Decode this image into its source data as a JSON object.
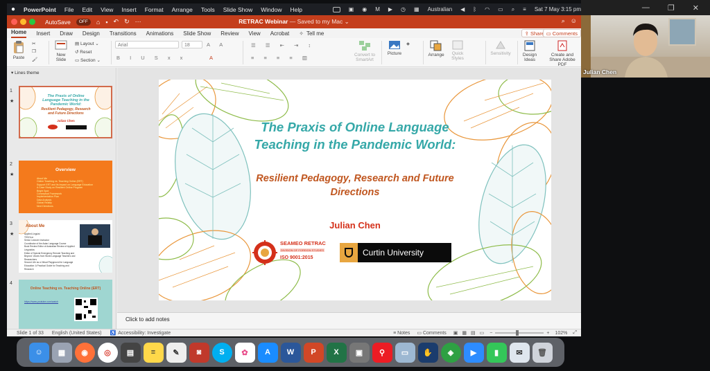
{
  "menubar": {
    "app": "PowerPoint",
    "items": [
      "File",
      "Edit",
      "View",
      "Insert",
      "Format",
      "Arrange",
      "Tools",
      "Slide Show",
      "Window",
      "Help"
    ],
    "language": "Australian",
    "datetime": "Sat 7 May  3:15 pm"
  },
  "titlebar": {
    "autosave_label": "AutoSave",
    "autosave_state": "OFF",
    "doc_name": "RETRAC Webinar",
    "saved_status": "— Saved to my Mac ⌄"
  },
  "tabs": [
    "Home",
    "Insert",
    "Draw",
    "Design",
    "Transitions",
    "Animations",
    "Slide Show",
    "Review",
    "View",
    "Acrobat"
  ],
  "tellme": "Tell me",
  "share_label": "Share",
  "comments_label": "Comments",
  "ribbon": {
    "paste": "Paste",
    "new_slide": "New Slide",
    "layout": "Layout ⌄",
    "reset": "Reset",
    "section": "Section ⌄",
    "font_name": "Arial",
    "font_size": "18",
    "convert_smartart": "Convert to SmartArt",
    "picture": "Picture",
    "arrange": "Arrange",
    "quick_styles": "Quick Styles",
    "sensitivity": "Sensitivity",
    "design_ideas": "Design Ideas",
    "create_share_pdf": "Create and Share Adobe PDF"
  },
  "thumbnails": {
    "panel_title": "Lines theme",
    "slides": [
      {
        "num": "1",
        "star": "★",
        "title": "The Praxis of Online Language Teaching in the Pandemic World:",
        "subtitle": "Resilient Pedagogy, Research and Future Directions",
        "author": "Julian Chen"
      },
      {
        "num": "2",
        "star": "★",
        "title": "Overview",
        "items": [
          "About Me",
          "Online Teaching vs. Teaching Online (ERT)",
          "Support ERT and Its Impact on Language Education",
          "A Case Study on Resilient Online Program",
          "Bright Spot",
          "Conceptual Framework",
          "Implementation Plan",
          "Data Analysis",
          "Global Reality",
          "Next Directions"
        ]
      },
      {
        "num": "3",
        "star": "★",
        "title": "About Me",
        "items": [
          "Applied Linguist",
          "TESOLer",
          "Senior Lecturer Instructor",
          "Coordinator of the Asian Language Course",
          "Book Review Editor of Australian Review of Applied Linguistics",
          "Editor of Special Emergency Remote Teaching and Beyond: Voices from World Language Teachers and Researchers",
          "Second Life as a Virtual Playground for Language Education: A Practical Guide for Teaching and Research"
        ]
      },
      {
        "num": "4",
        "star": "",
        "title": "Online Teaching vs. Teaching Online (ERT)",
        "link": "https://www.youtube.com/watch"
      }
    ]
  },
  "slide": {
    "title": "The Praxis of Online Language Teaching in the Pandemic World:",
    "subtitle": "Resilient Pedagogy, Research and Future Directions",
    "author": "Julian Chen",
    "seameo_name": "SEAMEO RETRAC",
    "seameo_division": "DIVISION OF FOREIGN STUDIES",
    "seameo_iso": "ISO 9001:2015",
    "curtin_name": "Curtin University"
  },
  "notes_placeholder": "Click to add notes",
  "status": {
    "slide_count": "Slide 1 of 33",
    "language": "English (United States)",
    "accessibility": "Accessibility: Investigate",
    "notes": "Notes",
    "comments": "Comments",
    "zoom": "102%"
  },
  "video": {
    "participant": "Julian Chen"
  },
  "dock": [
    "Finder",
    "Launchpad",
    "Firefox",
    "Chrome",
    "Calculator",
    "Notes",
    "TextEdit",
    "Photo Booth",
    "Skype",
    "Photos",
    "App Store",
    "Word",
    "PowerPoint",
    "Excel",
    "Screenshot",
    "Acrobat",
    "Preview",
    "Sign",
    "Chrome Remote",
    "Zoom",
    "FaceTime",
    "Mail",
    "Trash"
  ],
  "colors": {
    "accent": "#c43e1c",
    "teal": "#35a8a8",
    "orange_text": "#c0561f",
    "red_text": "#d4301a"
  }
}
